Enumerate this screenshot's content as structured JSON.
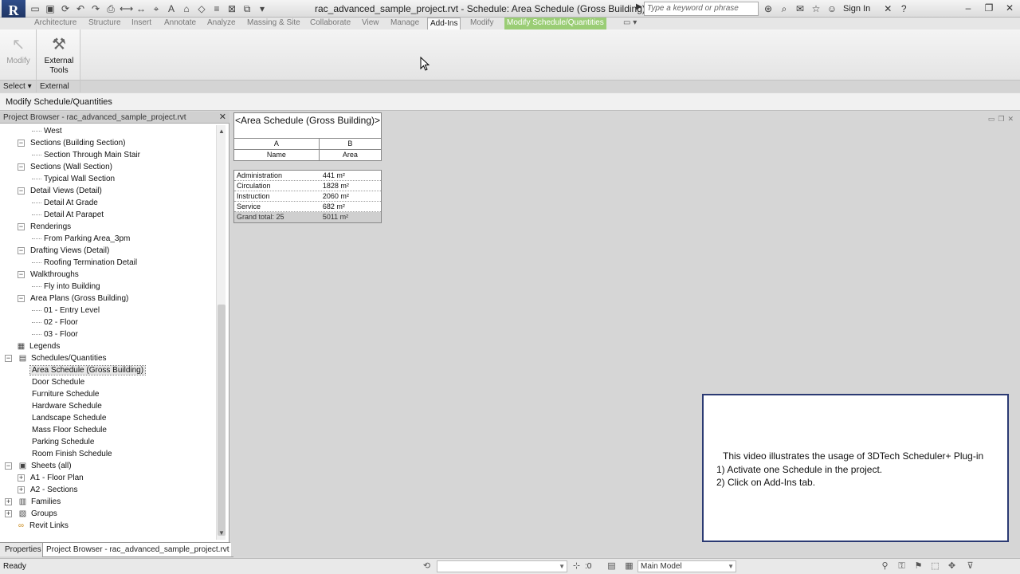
{
  "window": {
    "title": "rac_advanced_sample_project.rvt - Schedule: Area Schedule (Gross Building)",
    "app_logo": "R",
    "search_placeholder": "Type a keyword or phrase",
    "sign_in": "Sign In"
  },
  "ribbon": {
    "tabs": [
      {
        "label": "Architecture"
      },
      {
        "label": "Structure"
      },
      {
        "label": "Insert"
      },
      {
        "label": "Annotate"
      },
      {
        "label": "Analyze"
      },
      {
        "label": "Massing & Site"
      },
      {
        "label": "Collaborate"
      },
      {
        "label": "View"
      },
      {
        "label": "Manage"
      },
      {
        "label": "Add-Ins"
      },
      {
        "label": "Modify"
      },
      {
        "label": "Modify Schedule/Quantities"
      }
    ],
    "modify_label": "Modify",
    "external_tools_label": "External Tools",
    "select_group": "Select",
    "external_group": "External"
  },
  "options_bar": {
    "label": "Modify Schedule/Quantities"
  },
  "browser": {
    "title": "Project Browser - rac_advanced_sample_project.rvt",
    "items": [
      {
        "label": "West"
      },
      {
        "label": "Sections (Building Section)"
      },
      {
        "label": "Section Through Main Stair"
      },
      {
        "label": "Sections (Wall Section)"
      },
      {
        "label": "Typical Wall Section"
      },
      {
        "label": "Detail Views (Detail)"
      },
      {
        "label": "Detail At Grade"
      },
      {
        "label": "Detail At Parapet"
      },
      {
        "label": "Renderings"
      },
      {
        "label": "From Parking Area_3pm"
      },
      {
        "label": "Drafting Views (Detail)"
      },
      {
        "label": "Roofing Termination Detail"
      },
      {
        "label": "Walkthroughs"
      },
      {
        "label": "Fly into Building"
      },
      {
        "label": "Area Plans (Gross Building)"
      },
      {
        "label": "01 - Entry Level"
      },
      {
        "label": "02 - Floor"
      },
      {
        "label": "03 - Floor"
      },
      {
        "label": "Legends"
      },
      {
        "label": "Schedules/Quantities"
      },
      {
        "label": "Area Schedule (Gross Building)"
      },
      {
        "label": "Door Schedule"
      },
      {
        "label": "Furniture Schedule"
      },
      {
        "label": "Hardware Schedule"
      },
      {
        "label": "Landscape Schedule"
      },
      {
        "label": "Mass Floor Schedule"
      },
      {
        "label": "Parking Schedule"
      },
      {
        "label": "Room Finish Schedule"
      },
      {
        "label": "Sheets (all)"
      },
      {
        "label": "A1 - Floor Plan"
      },
      {
        "label": "A2 - Sections"
      },
      {
        "label": "Families"
      },
      {
        "label": "Groups"
      },
      {
        "label": "Revit Links"
      }
    ],
    "tabs": [
      {
        "label": "Properties"
      },
      {
        "label": "Project Browser - rac_advanced_sample_project.rvt"
      }
    ]
  },
  "schedule": {
    "title": "<Area Schedule (Gross Building)>",
    "col_a_letter": "A",
    "col_b_letter": "B",
    "col_a_header": "Name",
    "col_b_header": "Area",
    "rows": [
      {
        "name": "Administration",
        "area": "441 m²"
      },
      {
        "name": "Circulation",
        "area": "1828 m²"
      },
      {
        "name": "Instruction",
        "area": "2060 m²"
      },
      {
        "name": "Service",
        "area": "682 m²"
      }
    ],
    "total_label": "Grand total: 25",
    "total_area": "5011 m²"
  },
  "info_box": {
    "line1": "This video illustrates the usage of 3DTech Scheduler+ Plug-in",
    "line2": "1) Activate one Schedule in the project.",
    "line3": "2) Click on Add-Ins tab."
  },
  "status": {
    "text": "Ready",
    "coord_value": ":0",
    "model_combo": "Main Model"
  }
}
